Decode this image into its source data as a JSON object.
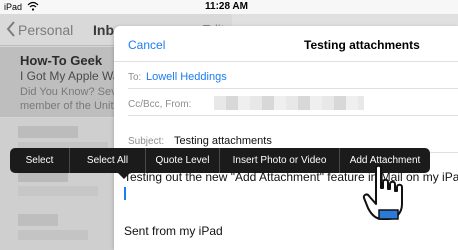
{
  "status_bar": {
    "carrier": "iPad",
    "time": "11:28 AM"
  },
  "inbox": {
    "back_label": "Personal",
    "title": "Inbox",
    "edit_label": "Edit",
    "selected_message": {
      "sender": "How-To Geek",
      "subject": "I Got My Apple Wat",
      "preview_line1": "Did You Know? Sev",
      "preview_line2": "member of the Unit"
    }
  },
  "compose": {
    "cancel_label": "Cancel",
    "title": "Testing attachments",
    "to_label": "To:",
    "to_value": "Lowell Heddings",
    "cc_label": "Cc/Bcc, From:",
    "subject_label": "Subject:",
    "subject_value": "Testing attachments",
    "body_text": "Testing out the new \"Add Attachment\" feature in Mail on my iPad",
    "signature": "Sent from my iPad"
  },
  "edit_menu": {
    "items": [
      "Select",
      "Select All",
      "Quote Level",
      "Insert Photo or Video",
      "Add Attachment"
    ]
  },
  "colors": {
    "accent": "#1e7cf2",
    "menu_bg": "#1b1b1b"
  },
  "icons": [
    "wifi-icon",
    "back-chevron-icon",
    "hand-pointer-icon"
  ]
}
